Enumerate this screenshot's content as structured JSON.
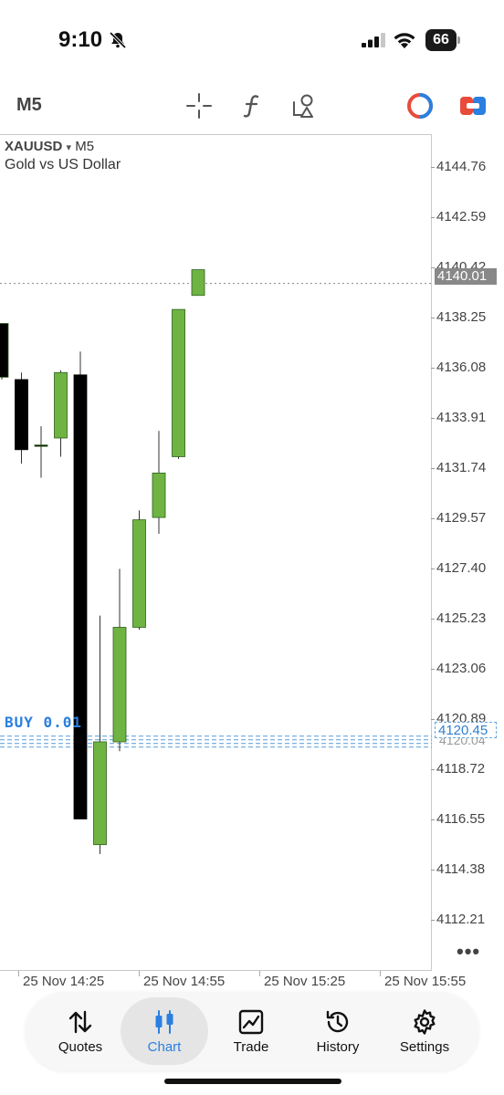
{
  "status": {
    "time": "9:10",
    "battery": "66"
  },
  "toolbar": {
    "timeframe": "M5"
  },
  "chart": {
    "symbol": "XAUUSD",
    "symbol_arrow": "▾",
    "symbol_timeframe": "M5",
    "description": "Gold vs US Dollar",
    "price_ticks": [
      "4144.76",
      "4142.59",
      "4140.42",
      "4138.25",
      "4136.08",
      "4133.91",
      "4131.74",
      "4129.57",
      "4127.40",
      "4125.23",
      "4123.06",
      "4120.89",
      "4118.72",
      "4116.55",
      "4114.38",
      "4112.21"
    ],
    "current_price": "4140.01",
    "buy_price": "4120.45",
    "buy_price_secondary": "4120.04",
    "buy_label": "BUY 0.01",
    "time_labels": [
      "25 Nov 14:25",
      "25 Nov 14:55",
      "25 Nov 15:25",
      "25 Nov 15:55"
    ],
    "overflow": "•••"
  },
  "chart_data": {
    "type": "candlestick",
    "symbol": "XAUUSD",
    "timeframe": "M5",
    "ylim": [
      4110.6,
      4146.4
    ],
    "candles": [
      {
        "open": 4136.0,
        "high": 4138.3,
        "low": 4135.9,
        "close": 4138.3,
        "color": "#000000"
      },
      {
        "open": 4135.9,
        "high": 4136.2,
        "low": 4132.3,
        "close": 4132.9,
        "color": "#000000"
      },
      {
        "open": 4133.1,
        "high": 4133.9,
        "low": 4131.7,
        "close": 4133.1,
        "color": "#000000"
      },
      {
        "open": 4133.4,
        "high": 4136.3,
        "low": 4132.6,
        "close": 4136.2,
        "color": "#6fb443"
      },
      {
        "open": 4136.1,
        "high": 4137.1,
        "low": 4117.1,
        "close": 4117.1,
        "color": "#000000"
      },
      {
        "open": 4116.0,
        "high": 4125.8,
        "low": 4115.6,
        "close": 4120.4,
        "color": "#6fb443"
      },
      {
        "open": 4120.4,
        "high": 4127.8,
        "low": 4120.0,
        "close": 4125.3,
        "color": "#6fb443"
      },
      {
        "open": 4125.3,
        "high": 4130.3,
        "low": 4125.2,
        "close": 4129.9,
        "color": "#6fb443"
      },
      {
        "open": 4130.0,
        "high": 4133.7,
        "low": 4129.3,
        "close": 4131.9,
        "color": "#6fb443"
      },
      {
        "open": 4132.6,
        "high": 4138.9,
        "low": 4132.5,
        "close": 4138.9,
        "color": "#6fb443"
      },
      {
        "open": 4139.5,
        "high": 4140.6,
        "low": 4139.5,
        "close": 4140.6,
        "color": "#6fb443"
      }
    ],
    "current_price": 4140.01,
    "order_line": 4120.45,
    "order_label": "BUY 0.01",
    "x_labels": [
      "25 Nov 14:25",
      "25 Nov 14:55",
      "25 Nov 15:25",
      "25 Nov 15:55"
    ]
  },
  "tabs": [
    {
      "label": "Quotes",
      "icon": "quotes-arrows-icon"
    },
    {
      "label": "Chart",
      "icon": "candlestick-chart-icon",
      "active": true
    },
    {
      "label": "Trade",
      "icon": "trade-chart-icon"
    },
    {
      "label": "History",
      "icon": "history-clock-icon"
    },
    {
      "label": "Settings",
      "icon": "settings-gear-icon"
    }
  ],
  "colors": {
    "accent": "#2a7fe0",
    "bull": "#6fb443",
    "bear": "#000000"
  }
}
